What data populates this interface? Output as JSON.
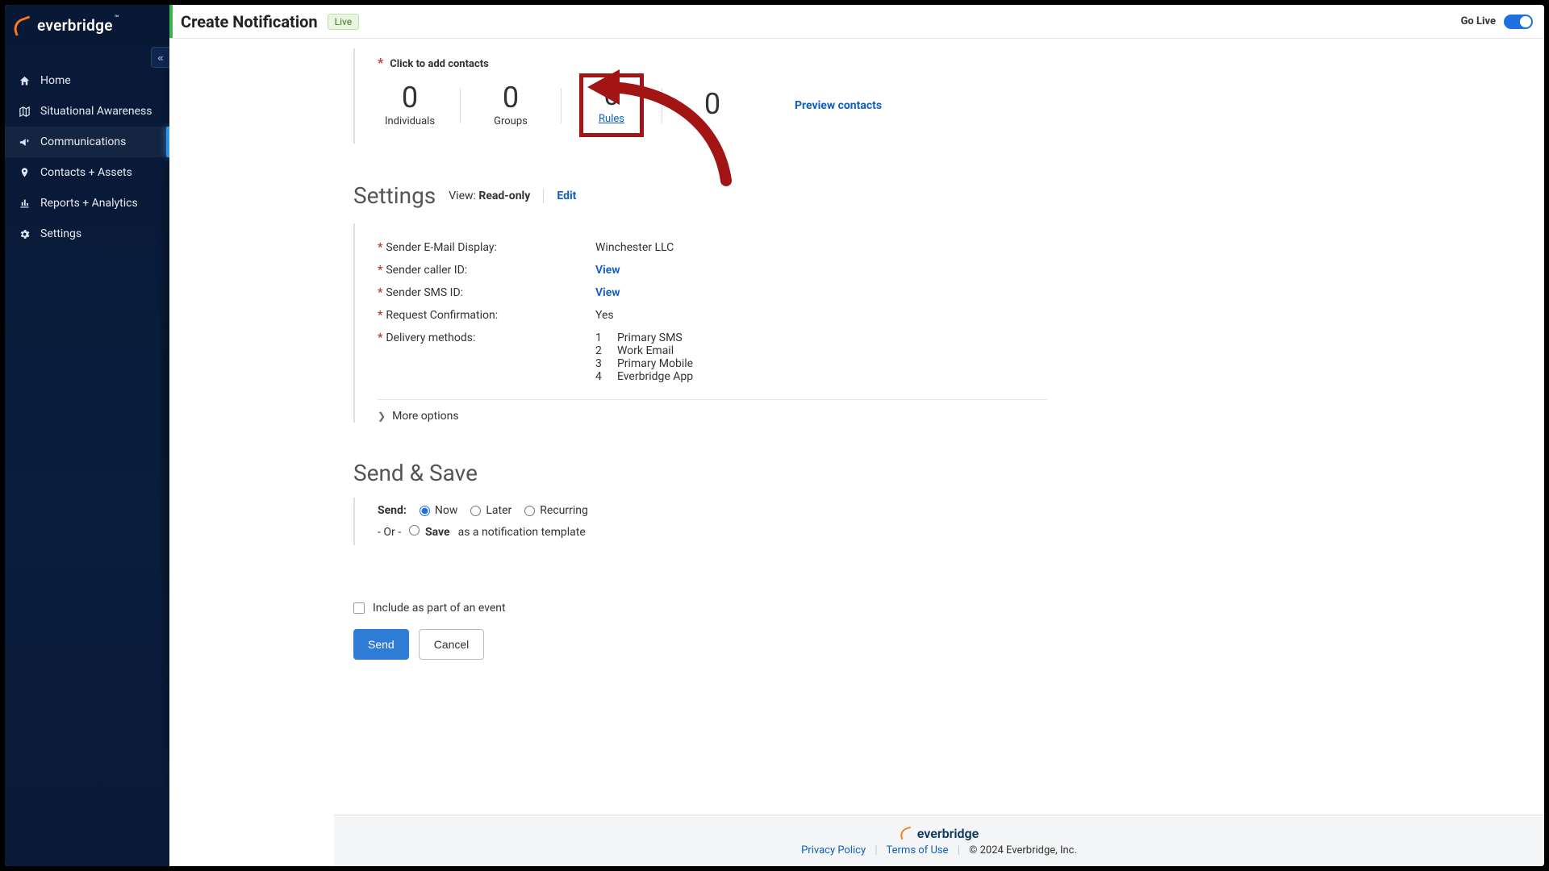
{
  "brand": {
    "name": "everbridge",
    "tm": "™"
  },
  "sidebar": {
    "collapse_glyph": "«",
    "items": [
      {
        "label": "Home"
      },
      {
        "label": "Situational Awareness"
      },
      {
        "label": "Communications"
      },
      {
        "label": "Contacts + Assets"
      },
      {
        "label": "Reports + Analytics"
      },
      {
        "label": "Settings"
      }
    ]
  },
  "header": {
    "title": "Create Notification",
    "badge": "Live",
    "go_live_label": "Go Live"
  },
  "contacts": {
    "click_label": "Click to add contacts",
    "individuals": {
      "count": "0",
      "label": "Individuals"
    },
    "groups": {
      "count": "0",
      "label": "Groups"
    },
    "rules": {
      "count": "0",
      "label": "Rules"
    },
    "fourth": {
      "count": "0",
      "label": ""
    },
    "preview": "Preview contacts"
  },
  "settings": {
    "heading": "Settings",
    "view_label": "View:",
    "view_value": "Read-only",
    "edit": "Edit",
    "rows": {
      "sender_email_display": {
        "label": "Sender E-Mail Display:",
        "value": "Winchester LLC"
      },
      "sender_caller_id": {
        "label": "Sender caller ID:",
        "value_link": "View"
      },
      "sender_sms_id": {
        "label": "Sender SMS ID:",
        "value_link": "View"
      },
      "request_confirmation": {
        "label": "Request Confirmation:",
        "value": "Yes"
      },
      "delivery_methods": {
        "label": "Delivery methods:",
        "items": [
          "Primary SMS",
          "Work Email",
          "Primary Mobile",
          "Everbridge App"
        ]
      }
    },
    "more_options": "More options"
  },
  "sendsave": {
    "heading": "Send & Save",
    "send_label": "Send:",
    "options": {
      "now": "Now",
      "later": "Later",
      "recurring": "Recurring"
    },
    "or": "- Or -",
    "save_option": "Save",
    "save_suffix": "as a notification template",
    "include_event": "Include as part of an event"
  },
  "buttons": {
    "send": "Send",
    "cancel": "Cancel"
  },
  "footer": {
    "privacy": "Privacy Policy",
    "terms": "Terms of Use",
    "copyright": "© 2024 Everbridge, Inc."
  }
}
